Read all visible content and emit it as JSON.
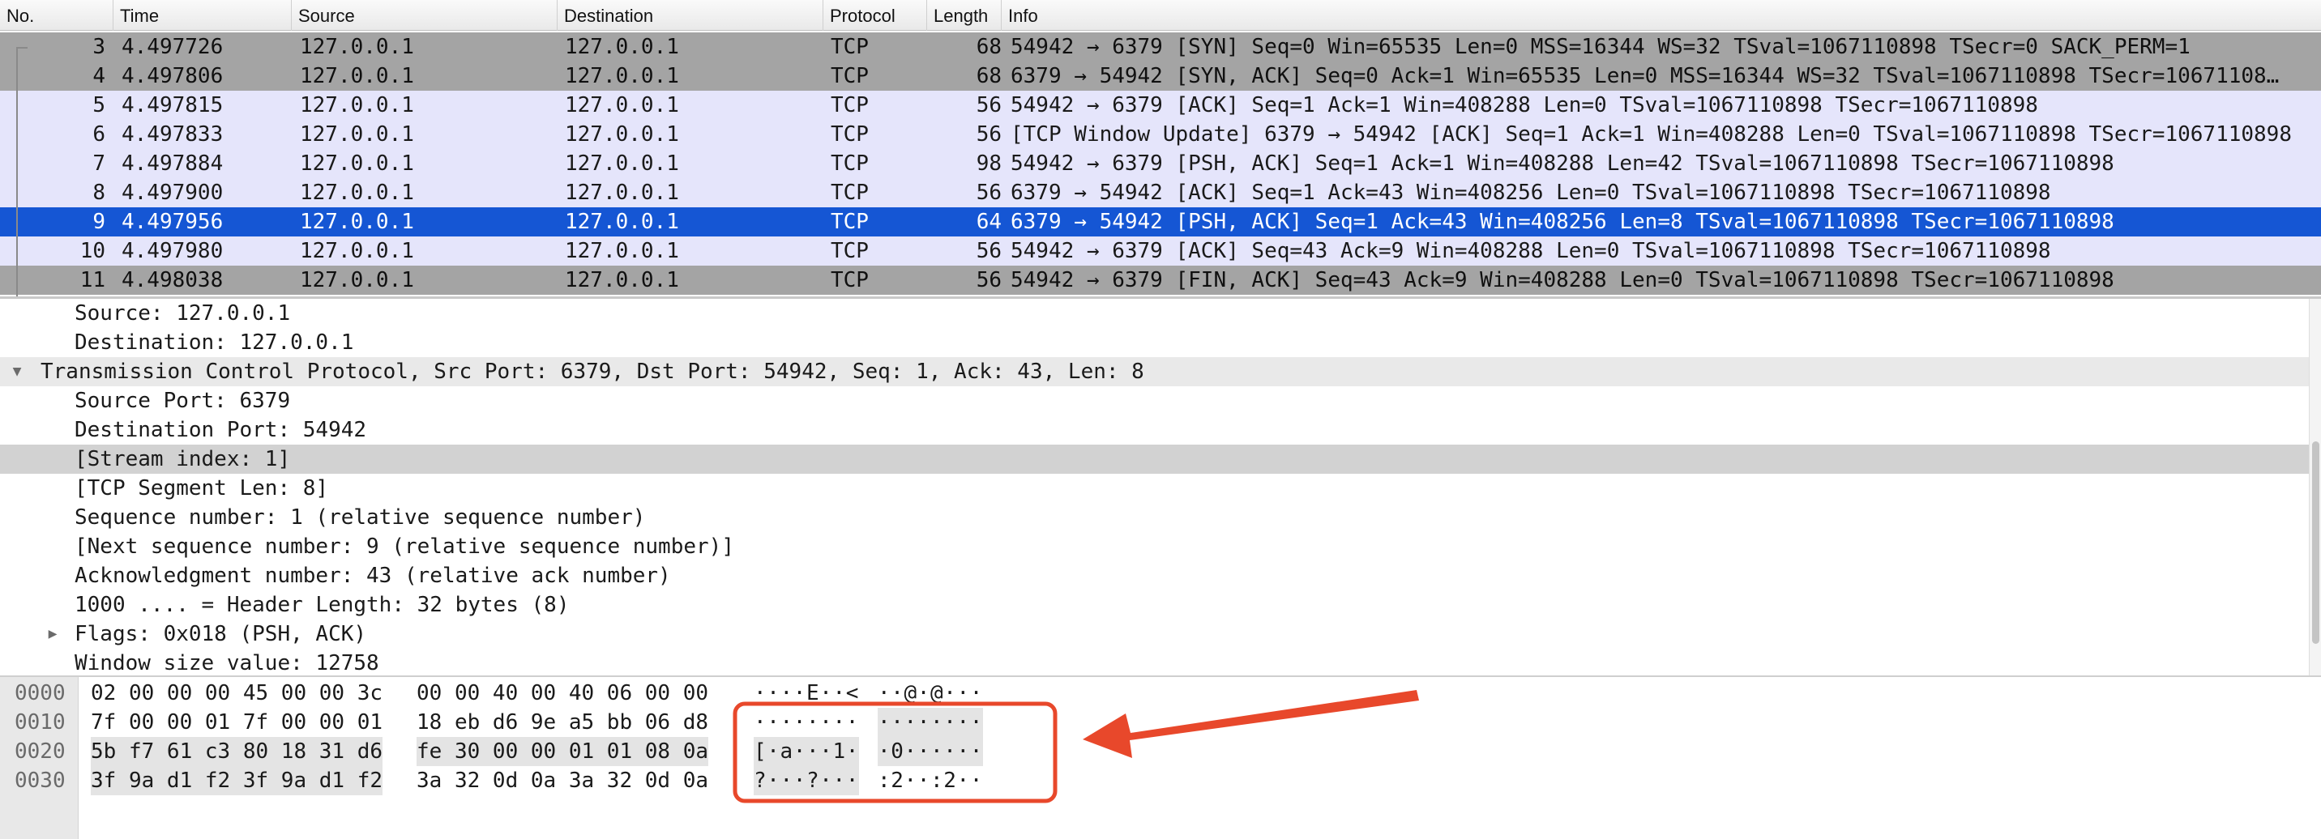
{
  "packet_list": {
    "columns": [
      "No.",
      "Time",
      "Source",
      "Destination",
      "Protocol",
      "Length",
      "Info"
    ],
    "rows": [
      {
        "no": "3",
        "time": "4.497726",
        "source": "127.0.0.1",
        "destination": "127.0.0.1",
        "protocol": "TCP",
        "length": "68",
        "info": "54942 → 6379 [SYN] Seq=0 Win=65535 Len=0 MSS=16344 WS=32 TSval=1067110898 TSecr=0 SACK_PERM=1",
        "style": "hs"
      },
      {
        "no": "4",
        "time": "4.497806",
        "source": "127.0.0.1",
        "destination": "127.0.0.1",
        "protocol": "TCP",
        "length": "68",
        "info": "6379 → 54942 [SYN, ACK] Seq=0 Ack=1 Win=65535 Len=0 MSS=16344 WS=32 TSval=1067110898 TSecr=10671108…",
        "style": "hs"
      },
      {
        "no": "5",
        "time": "4.497815",
        "source": "127.0.0.1",
        "destination": "127.0.0.1",
        "protocol": "TCP",
        "length": "56",
        "info": "54942 → 6379 [ACK] Seq=1 Ack=1 Win=408288 Len=0 TSval=1067110898 TSecr=1067110898",
        "style": "tcp"
      },
      {
        "no": "6",
        "time": "4.497833",
        "source": "127.0.0.1",
        "destination": "127.0.0.1",
        "protocol": "TCP",
        "length": "56",
        "info": "[TCP Window Update] 6379 → 54942 [ACK] Seq=1 Ack=1 Win=408288 Len=0 TSval=1067110898 TSecr=1067110898",
        "style": "tcp"
      },
      {
        "no": "7",
        "time": "4.497884",
        "source": "127.0.0.1",
        "destination": "127.0.0.1",
        "protocol": "TCP",
        "length": "98",
        "info": "54942 → 6379 [PSH, ACK] Seq=1 Ack=1 Win=408288 Len=42 TSval=1067110898 TSecr=1067110898",
        "style": "tcp"
      },
      {
        "no": "8",
        "time": "4.497900",
        "source": "127.0.0.1",
        "destination": "127.0.0.1",
        "protocol": "TCP",
        "length": "56",
        "info": "6379 → 54942 [ACK] Seq=1 Ack=43 Win=408256 Len=0 TSval=1067110898 TSecr=1067110898",
        "style": "tcp"
      },
      {
        "no": "9",
        "time": "4.497956",
        "source": "127.0.0.1",
        "destination": "127.0.0.1",
        "protocol": "TCP",
        "length": "64",
        "info": "6379 → 54942 [PSH, ACK] Seq=1 Ack=43 Win=408256 Len=8 TSval=1067110898 TSecr=1067110898",
        "style": "sel"
      },
      {
        "no": "10",
        "time": "4.497980",
        "source": "127.0.0.1",
        "destination": "127.0.0.1",
        "protocol": "TCP",
        "length": "56",
        "info": "54942 → 6379 [ACK] Seq=43 Ack=9 Win=408288 Len=0 TSval=1067110898 TSecr=1067110898",
        "style": "tcp"
      },
      {
        "no": "11",
        "time": "4.498038",
        "source": "127.0.0.1",
        "destination": "127.0.0.1",
        "protocol": "TCP",
        "length": "56",
        "info": "54942 → 6379 [FIN, ACK] Seq=43 Ack=9 Win=408288 Len=0 TSval=1067110898 TSecr=1067110898",
        "style": "hs"
      }
    ]
  },
  "details": [
    {
      "text": "Source: 127.0.0.1",
      "level": 1,
      "expander": "",
      "style": ""
    },
    {
      "text": "Destination: 127.0.0.1",
      "level": 1,
      "expander": "",
      "style": ""
    },
    {
      "text": "Transmission Control Protocol, Src Port: 6379, Dst Port: 54942, Seq: 1, Ack: 43, Len: 8",
      "level": 0,
      "expander": "▼",
      "style": "hl"
    },
    {
      "text": "Source Port: 6379",
      "level": 1,
      "expander": "",
      "style": ""
    },
    {
      "text": "Destination Port: 54942",
      "level": 1,
      "expander": "",
      "style": ""
    },
    {
      "text": "[Stream index: 1]",
      "level": 1,
      "expander": "",
      "style": "sel"
    },
    {
      "text": "[TCP Segment Len: 8]",
      "level": 1,
      "expander": "",
      "style": ""
    },
    {
      "text": "Sequence number: 1    (relative sequence number)",
      "level": 1,
      "expander": "",
      "style": ""
    },
    {
      "text": "[Next sequence number: 9    (relative sequence number)]",
      "level": 1,
      "expander": "",
      "style": ""
    },
    {
      "text": "Acknowledgment number: 43    (relative ack number)",
      "level": 1,
      "expander": "",
      "style": ""
    },
    {
      "text": "1000 .... = Header Length: 32 bytes (8)",
      "level": 1,
      "expander": "",
      "style": ""
    },
    {
      "text": "Flags: 0x018 (PSH, ACK)",
      "level": 1,
      "expander": "▶",
      "style": ""
    },
    {
      "text": "Window size value: 12758",
      "level": 1,
      "expander": "",
      "style": ""
    }
  ],
  "bytes": [
    {
      "offset": "0000",
      "hex1": "02 00 00 00 45 00 00 3c",
      "hex2": "00 00 40 00 40 06 00 00",
      "ascii1": "····E··<",
      "ascii2": "··@·@···",
      "hl_hex1": false,
      "hl_hex2": false,
      "hl_ascii1": false,
      "hl_ascii2": false
    },
    {
      "offset": "0010",
      "hex1": "7f 00 00 01 7f 00 00 01",
      "hex2": "18 eb d6 9e a5 bb 06 d8",
      "ascii1": "········",
      "ascii2": "········",
      "hl_hex1": false,
      "hl_hex2": false,
      "hl_ascii1": false,
      "hl_ascii2": true
    },
    {
      "offset": "0020",
      "hex1": "5b f7 61 c3 80 18 31 d6",
      "hex2": "fe 30 00 00 01 01 08 0a",
      "ascii1": "[·a···1·",
      "ascii2": "·0······",
      "hl_hex1": true,
      "hl_hex2": true,
      "hl_ascii1": true,
      "hl_ascii2": true
    },
    {
      "offset": "0030",
      "hex1": "3f 9a d1 f2 3f 9a d1 f2",
      "hex2": "3a 32 0d 0a 3a 32 0d 0a",
      "ascii1": "?···?···",
      "ascii2": ":2··:2··",
      "hl_hex1": true,
      "hl_hex2": false,
      "hl_ascii1": true,
      "hl_ascii2": false
    }
  ],
  "colors": {
    "selected_row": "#1556d4",
    "tcp_row": "#e5e5fb",
    "handshake_row": "#a4a4a4",
    "annotation": "#e8482b"
  }
}
